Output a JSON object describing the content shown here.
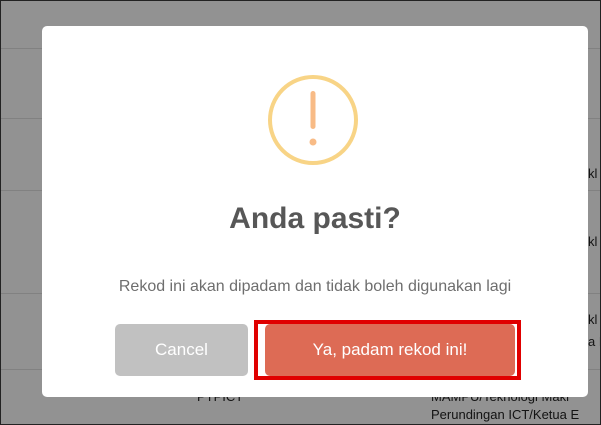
{
  "dialog": {
    "icon": "warning-exclamation-icon",
    "title": "Anda pasti?",
    "message": "Rekod ini akan dipadam dan tidak boleh digunakan lagi",
    "cancel_label": "Cancel",
    "confirm_label": "Ya, padam rekod ini!",
    "confirm_color": "#dd6b55",
    "cancel_color": "#c1c1c1",
    "icon_color": "#f8bb86"
  },
  "background": {
    "row_fragments": [
      "kl",
      "kl",
      "kl",
      "a F",
      "PTPICT",
      "MAMPU/Teknologi Makl",
      "Perundingan ICT/Ketua E"
    ]
  }
}
